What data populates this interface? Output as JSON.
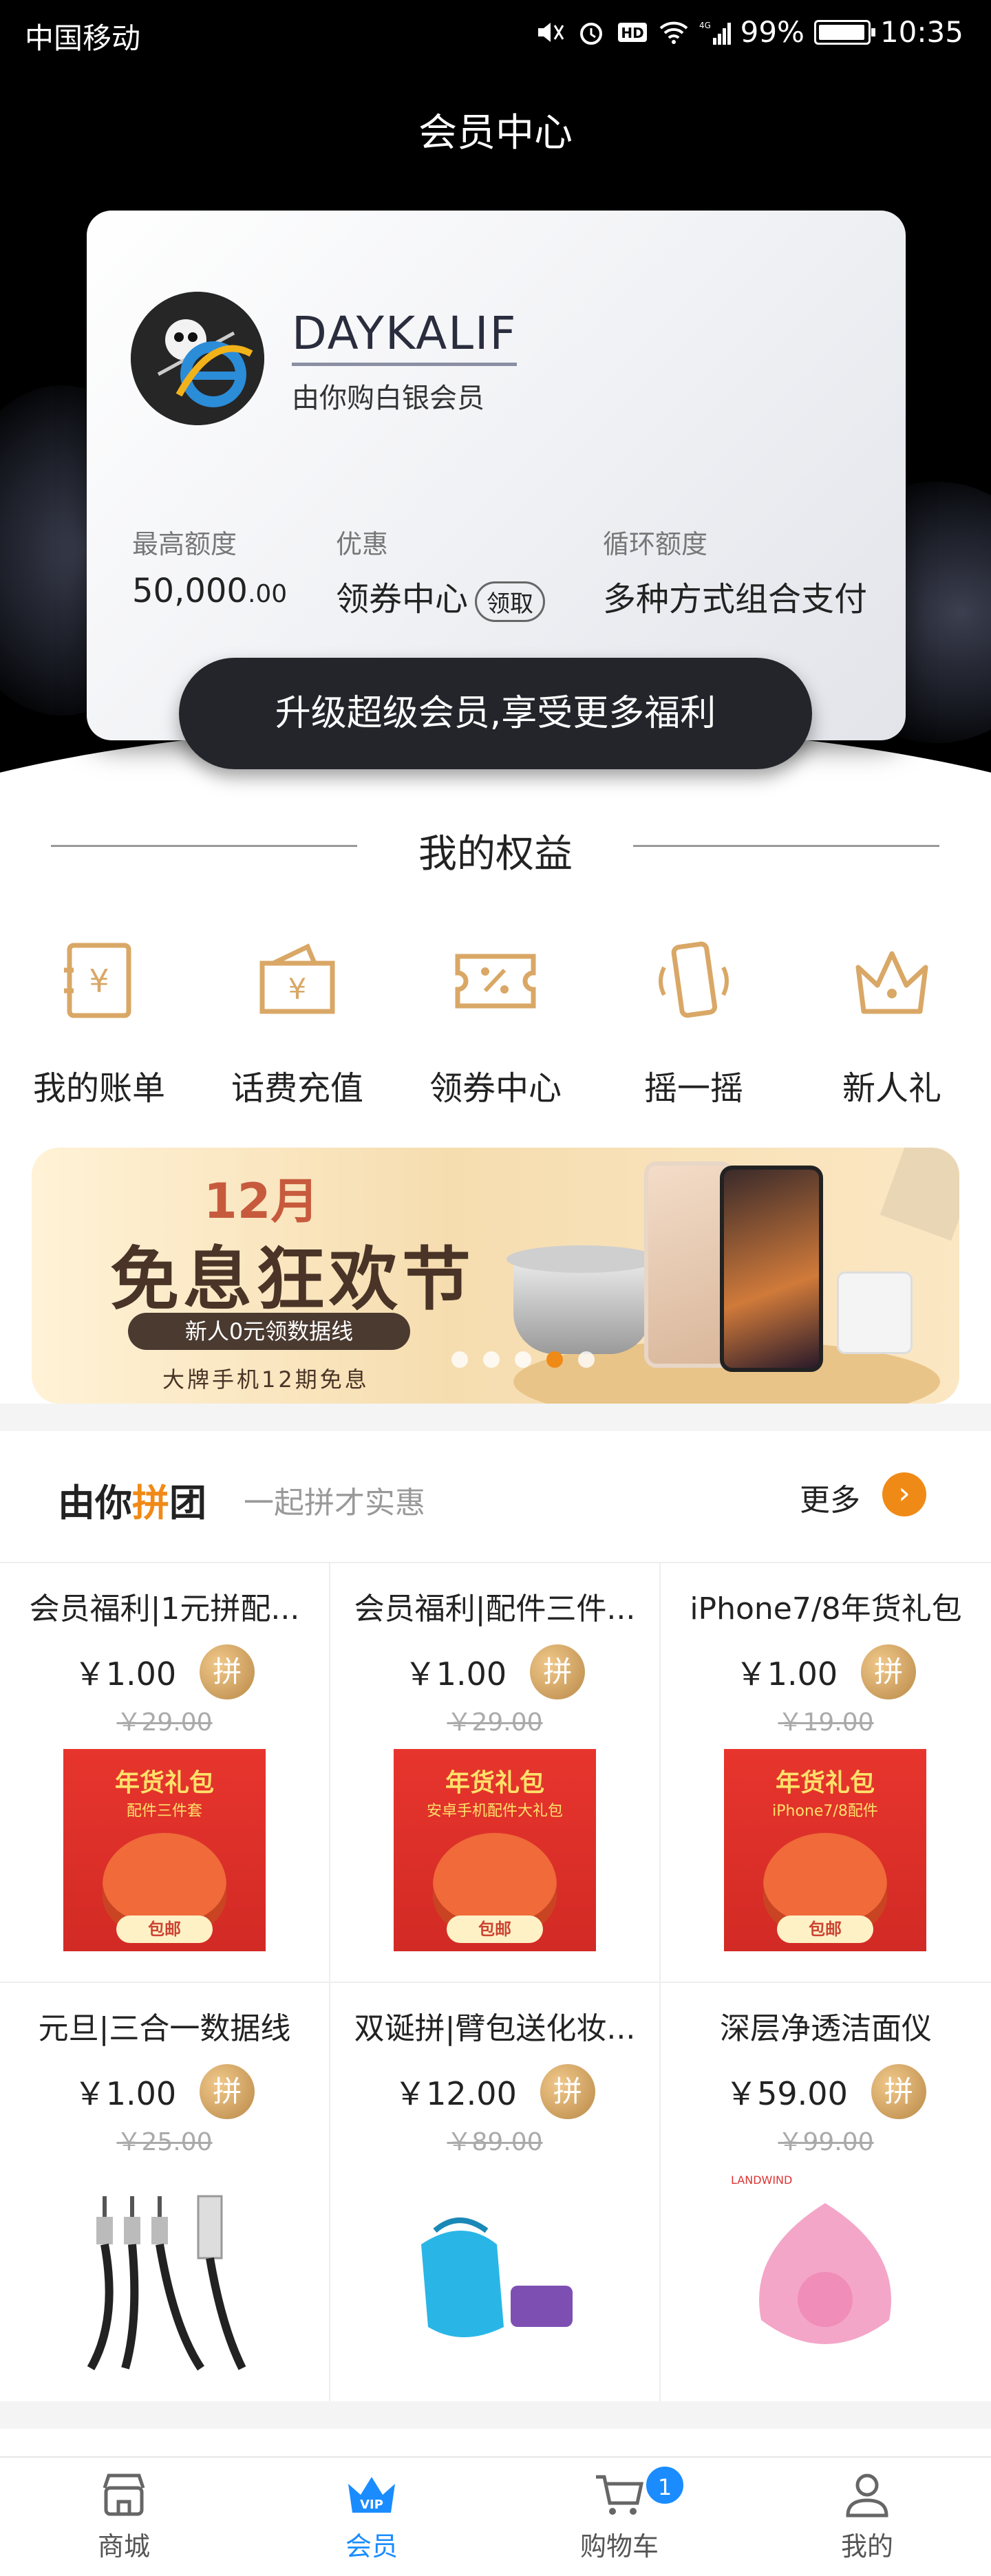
{
  "status_bar": {
    "carrier": "中国移动",
    "battery": "99%",
    "time": "10:35",
    "network": "4G"
  },
  "header": {
    "title": "会员中心"
  },
  "member_card": {
    "username": "DAYKALIF",
    "level": "由你购白银会员",
    "stats": [
      {
        "label": "最高额度",
        "value": "50,000",
        "decimals": ".00"
      },
      {
        "label": "优惠",
        "value": "领券中心",
        "action": "领取"
      },
      {
        "label": "循环额度",
        "value": "多种方式组合支付"
      }
    ],
    "upgrade_label": "升级超级会员,享受更多福利"
  },
  "benefits": {
    "title": "我的权益",
    "items": [
      {
        "label": "我的账单",
        "icon": "bill-icon"
      },
      {
        "label": "话费充值",
        "icon": "recharge-icon"
      },
      {
        "label": "领券中心",
        "icon": "coupon-icon"
      },
      {
        "label": "摇一摇",
        "icon": "shake-icon"
      },
      {
        "label": "新人礼",
        "icon": "crown-icon"
      }
    ]
  },
  "banner": {
    "month": "12月",
    "title": "免息狂欢节",
    "tag": "新人0元领数据线",
    "subtitle": "大牌手机12期免息",
    "dots": 5,
    "active_dot": 4
  },
  "group_buy": {
    "title_prefix": "由你",
    "title_highlight": "拼",
    "title_suffix": "团",
    "subtitle": "一起拼才实惠",
    "more_label": "更多",
    "pin_label": "拼",
    "products": [
      {
        "name": "会员福利|1元拼配...",
        "price": "￥1.00",
        "original": "￥29.00",
        "image": "gift-pack",
        "img_title": "年货礼包",
        "img_sub": "配件三件套",
        "img_ship": "包邮"
      },
      {
        "name": "会员福利|配件三件...",
        "price": "￥1.00",
        "original": "￥29.00",
        "image": "gift-pack",
        "img_title": "年货礼包",
        "img_sub": "安卓手机配件大礼包",
        "img_ship": "包邮"
      },
      {
        "name": "iPhone7/8年货礼包",
        "price": "￥1.00",
        "original": "￥19.00",
        "image": "gift-pack",
        "img_title": "年货礼包",
        "img_sub": "iPhone7/8配件",
        "img_ship": "包邮"
      },
      {
        "name": "元旦|三合一数据线",
        "price": "￥1.00",
        "original": "￥25.00",
        "image": "cable"
      },
      {
        "name": "双诞拼|臂包送化妆...",
        "price": "￥12.00",
        "original": "￥89.00",
        "image": "armbag"
      },
      {
        "name": "深层净透洁面仪",
        "price": "￥59.00",
        "original": "￥99.00",
        "image": "cleanser",
        "img_brand": "LANDWIND"
      }
    ]
  },
  "tabbar": {
    "items": [
      {
        "label": "商城",
        "icon": "store-icon"
      },
      {
        "label": "会员",
        "icon": "vip-crown-icon",
        "icon_text": "VIP",
        "active": true
      },
      {
        "label": "购物车",
        "icon": "cart-icon",
        "badge": "1"
      },
      {
        "label": "我的",
        "icon": "user-icon"
      }
    ]
  },
  "colors": {
    "accent": "#f08a17",
    "active_tab": "#1a8cff",
    "icon_gold": "#d9a766"
  }
}
